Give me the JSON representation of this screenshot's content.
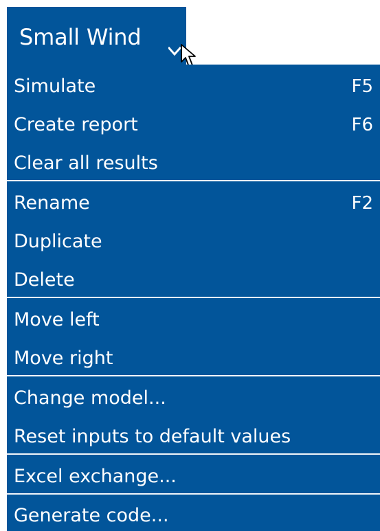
{
  "tab": {
    "title": "Small Wind",
    "icon": "chevron-down-icon"
  },
  "menu": {
    "items": [
      {
        "label": "Simulate",
        "shortcut": "F5"
      },
      {
        "label": "Create report",
        "shortcut": "F6"
      },
      {
        "label": "Clear all results",
        "shortcut": ""
      },
      {
        "label": "Rename",
        "shortcut": "F2"
      },
      {
        "label": "Duplicate",
        "shortcut": ""
      },
      {
        "label": "Delete",
        "shortcut": ""
      },
      {
        "label": "Move left",
        "shortcut": ""
      },
      {
        "label": "Move right",
        "shortcut": ""
      },
      {
        "label": "Change model...",
        "shortcut": ""
      },
      {
        "label": "Reset inputs to default values",
        "shortcut": ""
      },
      {
        "label": "Excel exchange...",
        "shortcut": ""
      },
      {
        "label": "Generate code...",
        "shortcut": ""
      }
    ]
  },
  "colors": {
    "menu_background": "#02559a",
    "text": "#ffffff"
  }
}
